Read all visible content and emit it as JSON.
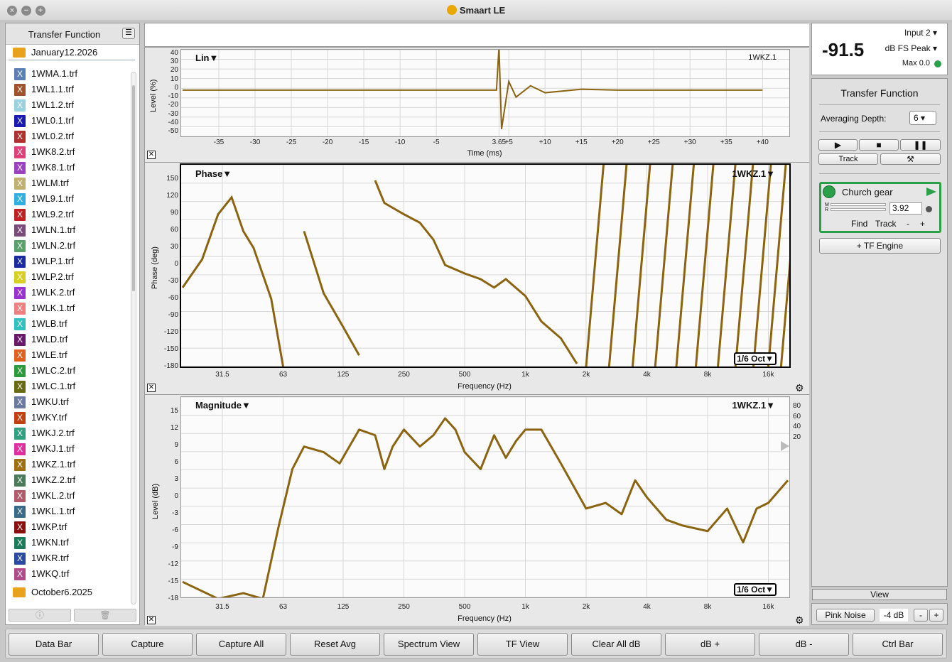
{
  "window": {
    "title": "Smaart LE"
  },
  "sidebar": {
    "title": "Transfer Function",
    "folders": [
      "January12.2026",
      "October6.2025"
    ],
    "files": [
      {
        "name": "1WMA.1.trf",
        "color": "#5b7fb5"
      },
      {
        "name": "1WL1.1.trf",
        "color": "#a0522d"
      },
      {
        "name": "1WL1.2.trf",
        "color": "#9ad0e0"
      },
      {
        "name": "1WL0.1.trf",
        "color": "#1a1ab0"
      },
      {
        "name": "1WL0.2.trf",
        "color": "#b03030"
      },
      {
        "name": "1WK8.2.trf",
        "color": "#e0407a"
      },
      {
        "name": "1WK8.1.trf",
        "color": "#9a40c0"
      },
      {
        "name": "1WLM.trf",
        "color": "#c0b070"
      },
      {
        "name": "1WL9.1.trf",
        "color": "#30b0e0"
      },
      {
        "name": "1WL9.2.trf",
        "color": "#c02020"
      },
      {
        "name": "1WLN.1.trf",
        "color": "#7a4a7a"
      },
      {
        "name": "1WLN.2.trf",
        "color": "#5aa06a"
      },
      {
        "name": "1WLP.1.trf",
        "color": "#1a2aa0"
      },
      {
        "name": "1WLP.2.trf",
        "color": "#d8d020"
      },
      {
        "name": "1WLK.2.trf",
        "color": "#9a30d0"
      },
      {
        "name": "1WLK.1.trf",
        "color": "#f08080"
      },
      {
        "name": "1WLB.trf",
        "color": "#30c0c0"
      },
      {
        "name": "1WLD.trf",
        "color": "#6a1a6a"
      },
      {
        "name": "1WLE.trf",
        "color": "#e06020"
      },
      {
        "name": "1WLC.2.trf",
        "color": "#2a9a3a"
      },
      {
        "name": "1WLC.1.trf",
        "color": "#6a6a10"
      },
      {
        "name": "1WKU.trf",
        "color": "#6a7aa0"
      },
      {
        "name": "1WKY.trf",
        "color": "#c04010"
      },
      {
        "name": "1WKJ.2.trf",
        "color": "#30a080"
      },
      {
        "name": "1WKJ.1.trf",
        "color": "#e030a0"
      },
      {
        "name": "1WKZ.1.trf",
        "color": "#a07010"
      },
      {
        "name": "1WKZ.2.trf",
        "color": "#4a7a5a"
      },
      {
        "name": "1WKL.2.trf",
        "color": "#b05a6a"
      },
      {
        "name": "1WKL.1.trf",
        "color": "#3a6a8a"
      },
      {
        "name": "1WKP.trf",
        "color": "#8a1010"
      },
      {
        "name": "1WKN.trf",
        "color": "#1a7a5a"
      },
      {
        "name": "1WKR.trf",
        "color": "#2a4aa0"
      },
      {
        "name": "1WKQ.trf",
        "color": "#b04a8a"
      }
    ],
    "footer": {
      "info_icon": "info-icon",
      "trash_icon": "trash-icon"
    }
  },
  "impulse": {
    "mode": "Lin▼",
    "trace_name": "1WKZ.1",
    "ylabel": "Level (%)",
    "xlabel": "Time (ms)",
    "yticks": [
      "40",
      "30",
      "20",
      "10",
      "0",
      "-10",
      "-20",
      "-30",
      "-40",
      "-50"
    ],
    "xticks": [
      "-35",
      "-30",
      "-25",
      "-20",
      "-15",
      "-10",
      "-5",
      "3.65",
      "+5",
      "+10",
      "+15",
      "+20",
      "+25",
      "+30",
      "+35",
      "+40"
    ]
  },
  "phase": {
    "mode": "Phase▼",
    "trace_name": "1WKZ.1▼",
    "ylabel": "Phase (deg)",
    "xlabel": "Frequency (Hz)",
    "smoothing": "1/6 Oct▼",
    "yticks": [
      "150",
      "120",
      "90",
      "60",
      "30",
      "0",
      "-30",
      "-60",
      "-90",
      "-120",
      "-150",
      "-180"
    ],
    "xticks": [
      "31.5",
      "63",
      "125",
      "250",
      "500",
      "1k",
      "2k",
      "4k",
      "8k",
      "16k"
    ]
  },
  "magnitude": {
    "mode": "Magnitude▼",
    "trace_name": "1WKZ.1▼",
    "ylabel": "Level (dB)",
    "xlabel": "Frequency (Hz)",
    "smoothing": "1/6 Oct▼",
    "yticks": [
      "15",
      "12",
      "9",
      "6",
      "3",
      "0",
      "-3",
      "-6",
      "-9",
      "-12",
      "-15",
      "-18"
    ],
    "coherence_ticks": [
      "80",
      "60",
      "40",
      "20"
    ],
    "xticks": [
      "31.5",
      "63",
      "125",
      "250",
      "500",
      "1k",
      "2k",
      "4k",
      "8k",
      "16k"
    ]
  },
  "meter": {
    "value": "-91.5",
    "input": "Input 2",
    "mode": "dB FS Peak",
    "max": "Max 0.0"
  },
  "control": {
    "title": "Transfer Function",
    "averaging_label": "Averaging Depth:",
    "averaging_value": "6",
    "track_label": "Track",
    "engine_name": "Church gear",
    "delay_value": "3.92",
    "find_label": "Find",
    "track2_label": "Track",
    "minus": "-",
    "plus": "+",
    "add_engine": "+ TF Engine",
    "view_label": "View",
    "noise_label": "Pink Noise",
    "noise_level": "-4 dB",
    "noise_minus": "-",
    "noise_plus": "+"
  },
  "toolbar": [
    "Data Bar",
    "Capture",
    "Capture All",
    "Reset Avg",
    "Spectrum View",
    "TF View",
    "Clear All dB",
    "dB +",
    "dB -",
    "Ctrl Bar"
  ],
  "trace_color": "#8b6410",
  "chart_data": [
    {
      "type": "line",
      "title": "",
      "xlabel": "Time (ms)",
      "ylabel": "Level (%)",
      "ylim": [
        -50,
        40
      ],
      "x": [
        -40,
        -30,
        -20,
        -10,
        0,
        3.3,
        3.65,
        4,
        5,
        6,
        8,
        10,
        15,
        20,
        30,
        40
      ],
      "series": [
        {
          "values": [
            0,
            0,
            0,
            0,
            0,
            0,
            50,
            -45,
            10,
            -8,
            5,
            -3,
            1,
            0,
            0,
            0
          ]
        }
      ]
    },
    {
      "type": "line",
      "title": "",
      "xlabel": "Frequency (Hz)",
      "ylabel": "Phase (deg)",
      "ylim": [
        -180,
        180
      ],
      "x": [
        20,
        25,
        30,
        35,
        40,
        45,
        55,
        63,
        80,
        100,
        125,
        150,
        180,
        200,
        250,
        300,
        350,
        400,
        500,
        600,
        700,
        800,
        1000,
        1200,
        1500,
        1800,
        2000
      ],
      "series": [
        {
          "values": [
            -40,
            10,
            90,
            120,
            60,
            30,
            -60,
            -180,
            60,
            -50,
            -110,
            -160,
            150,
            110,
            90,
            75,
            45,
            0,
            -15,
            -25,
            -40,
            -25,
            -55,
            -100,
            -130,
            -175,
            150
          ]
        }
      ]
    },
    {
      "type": "line",
      "title": "",
      "xlabel": "Frequency (Hz)",
      "ylabel": "Level (dB)",
      "ylim": [
        -18,
        15
      ],
      "x": [
        20,
        30,
        40,
        50,
        60,
        70,
        80,
        100,
        120,
        150,
        180,
        200,
        220,
        250,
        300,
        350,
        400,
        450,
        500,
        600,
        700,
        800,
        900,
        1000,
        1200,
        1500,
        2000,
        2500,
        3000,
        3500,
        4000,
        5000,
        6000,
        8000,
        10000,
        12000,
        14000,
        16000,
        20000
      ],
      "series": [
        {
          "values": [
            -15,
            -18,
            -17,
            -18,
            -5,
            5,
            9,
            8,
            6,
            12,
            11,
            5,
            9,
            12,
            9,
            11,
            14,
            12,
            8,
            5,
            11,
            7,
            10,
            12,
            12,
            6,
            -2,
            -1,
            -3,
            3,
            0,
            -4,
            -5,
            -6,
            -2,
            -8,
            -2,
            -1,
            3
          ]
        }
      ]
    }
  ]
}
